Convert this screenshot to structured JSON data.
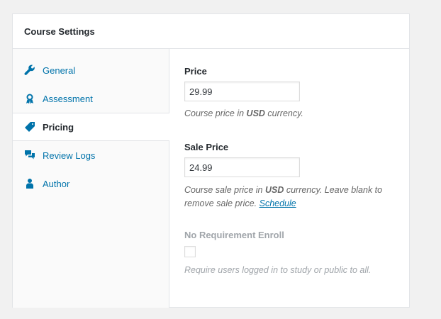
{
  "panel": {
    "title": "Course Settings"
  },
  "tabs": [
    {
      "label": "General",
      "icon": "wrench-icon"
    },
    {
      "label": "Assessment",
      "icon": "award-icon"
    },
    {
      "label": "Pricing",
      "icon": "price-tag-icon",
      "active": true
    },
    {
      "label": "Review Logs",
      "icon": "chat-bubbles-icon"
    },
    {
      "label": "Author",
      "icon": "user-icon"
    }
  ],
  "pricing": {
    "price": {
      "label": "Price",
      "value": "29.99",
      "desc_prefix": "Course price in ",
      "desc_currency": "USD",
      "desc_suffix": " currency."
    },
    "sale_price": {
      "label": "Sale Price",
      "value": "24.99",
      "desc_prefix": "Course sale price in ",
      "desc_currency": "USD",
      "desc_suffix": " currency. Leave blank to remove sale price. ",
      "schedule_link": "Schedule"
    },
    "no_requirement": {
      "label": "No Requirement Enroll",
      "checked": false,
      "desc": "Require users logged in to study or public to all."
    }
  },
  "colors": {
    "accent": "#0073aa",
    "text": "#23282d",
    "muted": "#666666",
    "disabled": "#a0a5aa"
  }
}
